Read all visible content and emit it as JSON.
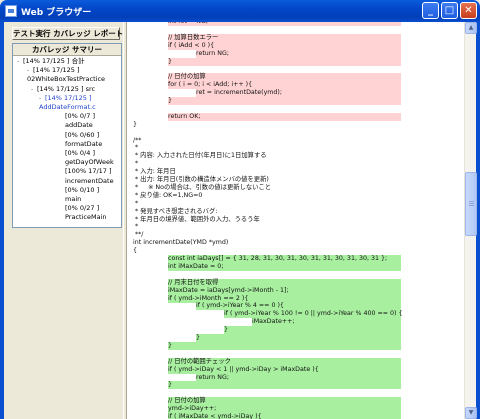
{
  "window": {
    "title": "Web ブラウザー"
  },
  "left": {
    "report_button": "テスト実行 カバレッジ レポート",
    "tree_header": "カバレッジ サマリー",
    "tree": [
      {
        "text": "[14% 17/125 ]  合計",
        "level": 0,
        "twisty": "-",
        "blue": false
      },
      {
        "text": "[14% 17/125 ]",
        "level": 1,
        "twisty": "-",
        "blue": false
      },
      {
        "text": "02WhiteBoxTestPractice",
        "level": 1,
        "twisty": "",
        "blue": false
      },
      {
        "text": "[14% 17/125 ]  src",
        "level": 2,
        "twisty": "-",
        "blue": false
      },
      {
        "text": "[14% 17/125 ]",
        "level": 3,
        "twisty": "-",
        "blue": true
      },
      {
        "text": "AddDateFormat.c",
        "level": 3,
        "twisty": "",
        "blue": true
      },
      {
        "text": "[0% 0/7 ]",
        "level": 4,
        "twisty": "",
        "blue": false
      },
      {
        "text": "addDate",
        "level": 4,
        "twisty": "",
        "blue": false
      },
      {
        "text": "[0% 0/60 ]",
        "level": 4,
        "twisty": "",
        "blue": false
      },
      {
        "text": "formatDate",
        "level": 4,
        "twisty": "",
        "blue": false
      },
      {
        "text": "[0% 0/4 ]",
        "level": 4,
        "twisty": "",
        "blue": false
      },
      {
        "text": "getDayOfWeek",
        "level": 4,
        "twisty": "",
        "blue": false
      },
      {
        "text": "[100% 17/17 ]",
        "level": 4,
        "twisty": "",
        "blue": false
      },
      {
        "text": "incrementDate",
        "level": 4,
        "twisty": "",
        "blue": false
      },
      {
        "text": "[0% 0/10 ]",
        "level": 4,
        "twisty": "",
        "blue": false
      },
      {
        "text": "main",
        "level": 4,
        "twisty": "",
        "blue": false
      },
      {
        "text": "[0% 0/27 ]",
        "level": 4,
        "twisty": "",
        "blue": false
      },
      {
        "text": "PracticeMain",
        "level": 4,
        "twisty": "",
        "blue": false
      }
    ]
  },
  "code": [
    {
      "text": "                    int ret = NG;",
      "hl": "red"
    },
    {
      "text": "",
      "hl": ""
    },
    {
      "text": "                    // 加算日数エラー",
      "hl": "red"
    },
    {
      "text": "                    if ( iAdd < 0 ){",
      "hl": "red"
    },
    {
      "text": "                                    return NG;",
      "hl": "red"
    },
    {
      "text": "                    }",
      "hl": "red"
    },
    {
      "text": "",
      "hl": ""
    },
    {
      "text": "                    // 日付の加算",
      "hl": "red"
    },
    {
      "text": "                    for ( i = 0; i < iAdd; i++ ){",
      "hl": "red"
    },
    {
      "text": "                                    ret = incrementDate(ymd);",
      "hl": "red"
    },
    {
      "text": "                    }",
      "hl": "red"
    },
    {
      "text": "",
      "hl": ""
    },
    {
      "text": "                    return OK;",
      "hl": "red"
    },
    {
      "text": "}",
      "hl": ""
    },
    {
      "text": "",
      "hl": ""
    },
    {
      "text": "/**",
      "hl": ""
    },
    {
      "text": " *",
      "hl": ""
    },
    {
      "text": " * 内容: 入力された日付(年月日)に1日加算する",
      "hl": ""
    },
    {
      "text": " *",
      "hl": ""
    },
    {
      "text": " * 入力: 年月日",
      "hl": ""
    },
    {
      "text": " * 出力: 年月日(引数の構造体メンバの値を更新)",
      "hl": ""
    },
    {
      "text": " *     ※ Noの場合は、引数の値は更新しないこと",
      "hl": ""
    },
    {
      "text": " * 戻り値: OK=1,NG=0",
      "hl": ""
    },
    {
      "text": " *",
      "hl": ""
    },
    {
      "text": " * 発見すべき想定されるバグ:",
      "hl": ""
    },
    {
      "text": " * 年月日の境界値、範囲外の入力、うるう年",
      "hl": ""
    },
    {
      "text": " *",
      "hl": ""
    },
    {
      "text": " **/",
      "hl": ""
    },
    {
      "text": "int incrementDate(YMD *ymd)",
      "hl": ""
    },
    {
      "text": "{",
      "hl": ""
    },
    {
      "text": "                    const int iaDays[] = { 31, 28, 31, 30, 31, 30, 31, 31, 30, 31, 30, 31 };",
      "hl": "green"
    },
    {
      "text": "                    int iMaxDate = 0;",
      "hl": "green"
    },
    {
      "text": "",
      "hl": ""
    },
    {
      "text": "                    // 月末日付を取得",
      "hl": "green"
    },
    {
      "text": "                    iMaxDate = iaDays[ymd->iMonth - 1];",
      "hl": "green"
    },
    {
      "text": "                    if ( ymd->iMonth == 2 ){",
      "hl": "green"
    },
    {
      "text": "                                    if ( ymd->iYear % 4 == 0 ){",
      "hl": "green"
    },
    {
      "text": "                                                    if ( ymd->iYear % 100 != 0 || ymd->iYear % 400 == 0) {",
      "hl": "green"
    },
    {
      "text": "                                                                    iMaxDate++;",
      "hl": "green"
    },
    {
      "text": "                                                    }",
      "hl": "green"
    },
    {
      "text": "                                    }",
      "hl": "green"
    },
    {
      "text": "                    }",
      "hl": "green"
    },
    {
      "text": "",
      "hl": ""
    },
    {
      "text": "                    // 日付の範囲チェック",
      "hl": "green"
    },
    {
      "text": "                    if ( ymd->iDay < 1 || ymd->iDay > iMaxDate ){",
      "hl": "green"
    },
    {
      "text": "                                    return NG;",
      "hl": "green"
    },
    {
      "text": "                    }",
      "hl": "green"
    },
    {
      "text": "",
      "hl": ""
    },
    {
      "text": "                    // 日付の加算",
      "hl": "green"
    },
    {
      "text": "                    ymd->iDay++;",
      "hl": "green"
    },
    {
      "text": "                    if ( iMaxDate < ymd->iDay ){",
      "hl": "green"
    }
  ]
}
